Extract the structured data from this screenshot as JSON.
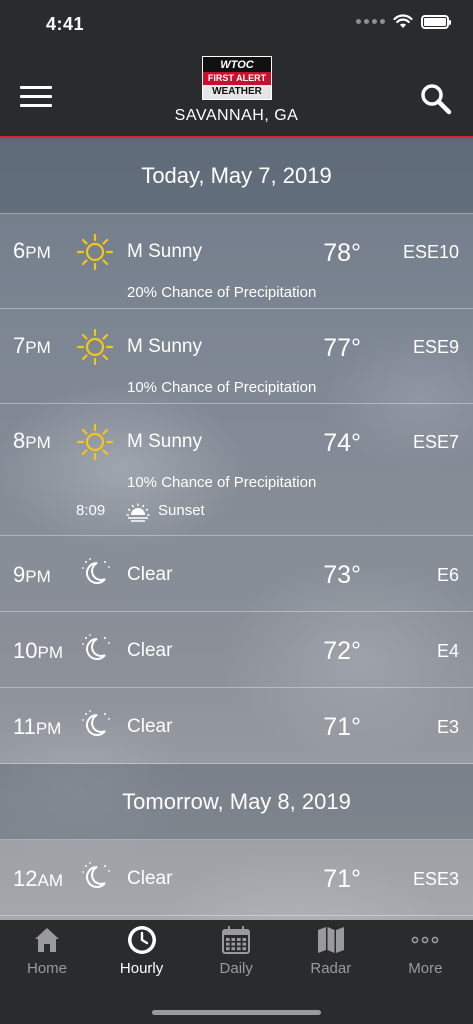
{
  "status_bar": {
    "time": "4:41"
  },
  "header": {
    "logo": {
      "line1": "WTOC",
      "line2": "FIRST ALERT",
      "line3": "WEATHER"
    },
    "location": "SAVANNAH, GA",
    "icons": {
      "menu": "menu-icon",
      "search": "search-icon"
    }
  },
  "sections": [
    {
      "date": "Today, May 7, 2019",
      "rows": [
        {
          "hour": "6",
          "ampm": "PM",
          "icon": "sun-icon",
          "condition": "M Sunny",
          "temp": "78°",
          "wind": "ESE10",
          "precip": "20% Chance of Precipitation"
        },
        {
          "hour": "7",
          "ampm": "PM",
          "icon": "sun-icon",
          "condition": "M Sunny",
          "temp": "77°",
          "wind": "ESE9",
          "precip": "10% Chance of Precipitation"
        },
        {
          "hour": "8",
          "ampm": "PM",
          "icon": "sun-icon",
          "condition": "M Sunny",
          "temp": "74°",
          "wind": "ESE7",
          "precip": "10% Chance of Precipitation",
          "sunset_time": "8:09",
          "sunset_label": "Sunset"
        },
        {
          "hour": "9",
          "ampm": "PM",
          "icon": "moon-icon",
          "condition": "Clear",
          "temp": "73°",
          "wind": "E6"
        },
        {
          "hour": "10",
          "ampm": "PM",
          "icon": "moon-icon",
          "condition": "Clear",
          "temp": "72°",
          "wind": "E4"
        },
        {
          "hour": "11",
          "ampm": "PM",
          "icon": "moon-icon",
          "condition": "Clear",
          "temp": "71°",
          "wind": "E3"
        }
      ]
    },
    {
      "date": "Tomorrow, May 8, 2019",
      "rows": [
        {
          "hour": "12",
          "ampm": "AM",
          "icon": "moon-icon",
          "condition": "Clear",
          "temp": "71°",
          "wind": "ESE3"
        }
      ]
    }
  ],
  "tabs": [
    {
      "label": "Home",
      "icon": "home-icon",
      "active": false
    },
    {
      "label": "Hourly",
      "icon": "clock-icon",
      "active": true
    },
    {
      "label": "Daily",
      "icon": "calendar-icon",
      "active": false
    },
    {
      "label": "Radar",
      "icon": "map-icon",
      "active": false
    },
    {
      "label": "More",
      "icon": "more-icon",
      "active": false
    }
  ],
  "colors": {
    "accent_red": "#d8232a",
    "header_bg": "#2a2b2d",
    "sun_yellow": "#f5c518"
  }
}
